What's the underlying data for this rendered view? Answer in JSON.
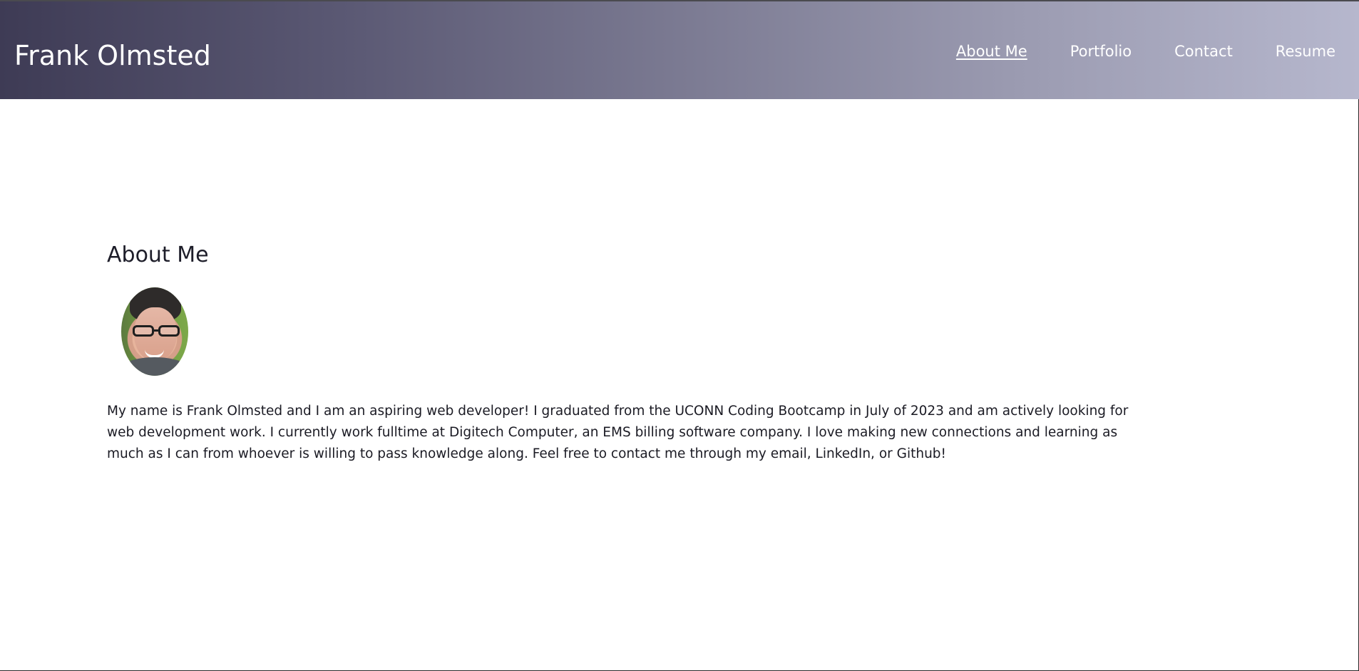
{
  "header": {
    "brand": "Frank Olmsted",
    "nav": {
      "about": "About Me",
      "portfolio": "Portfolio",
      "contact": "Contact",
      "resume": "Resume"
    }
  },
  "main": {
    "title": "About Me",
    "intro": "My name is Frank Olmsted and I am an aspiring web developer! I graduated from the UCONN Coding Bootcamp in July of 2023 and am actively looking for web development work. I currently work fulltime at Digitech Computer, an EMS billing software company. I love making new connections and learning as much as I can from whoever is willing to pass knowledge along. Feel free to contact me through my email, LinkedIn, or Github!"
  },
  "colors": {
    "header_start": "#3e3b55",
    "header_end": "#b6b7cd",
    "text": "#1b1b24",
    "background": "#ffffff"
  }
}
